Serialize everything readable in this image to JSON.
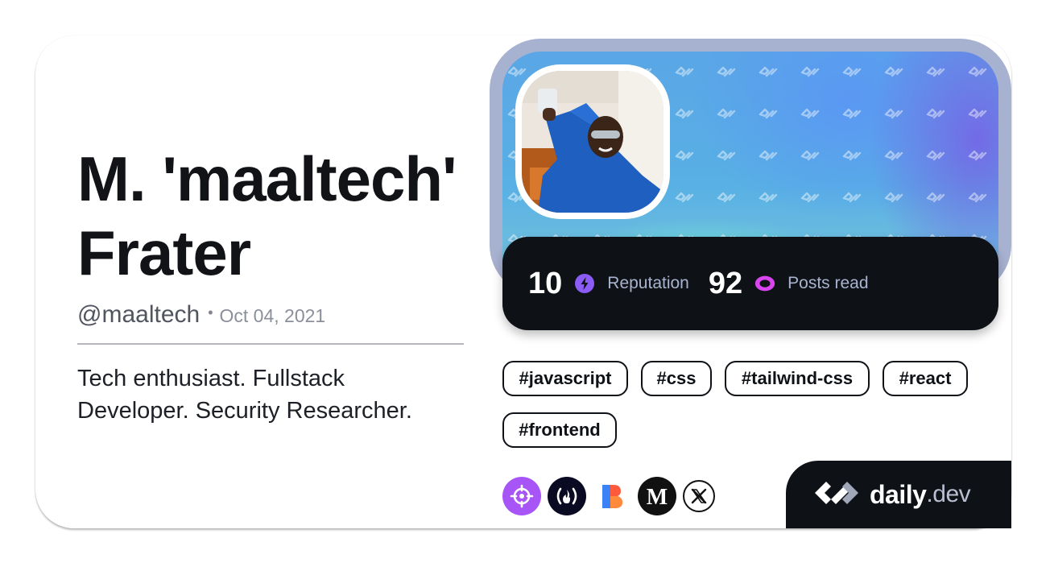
{
  "profile": {
    "name_line1": "M. 'maaltech'",
    "name_line2": "Frater",
    "handle": "@maaltech",
    "separator": "•",
    "joined": "Oct 04, 2021",
    "bio": "Tech enthusiast. Fullstack Developer. Security Researcher.",
    "avatar_alt": "profile photo"
  },
  "stats": {
    "reputation": {
      "value": "10",
      "label": "Reputation",
      "icon": "lightning-icon",
      "color": "#8b5cf6"
    },
    "posts_read": {
      "value": "92",
      "label": "Posts read",
      "icon": "eye-ring-icon",
      "color": "#d946ef"
    }
  },
  "tags": [
    "#javascript",
    "#css",
    "#tailwind-css",
    "#react",
    "#frontend"
  ],
  "socials": [
    {
      "name": "crosshair-icon",
      "bg": "#a855f7"
    },
    {
      "name": "freecodecamp-icon",
      "bg": "#0a0a23"
    },
    {
      "name": "bento-icon",
      "bg": "#ffffff"
    },
    {
      "name": "medium-icon",
      "bg": "#111111"
    },
    {
      "name": "x-icon",
      "bg": "#ffffff"
    }
  ],
  "brand": {
    "name_bold": "daily",
    "name_suffix": ".dev"
  },
  "colors": {
    "text_dark": "#111317",
    "panel_dark": "#0e1217",
    "muted": "#a8b3cf",
    "cover_frame": "#a7b1d0"
  }
}
